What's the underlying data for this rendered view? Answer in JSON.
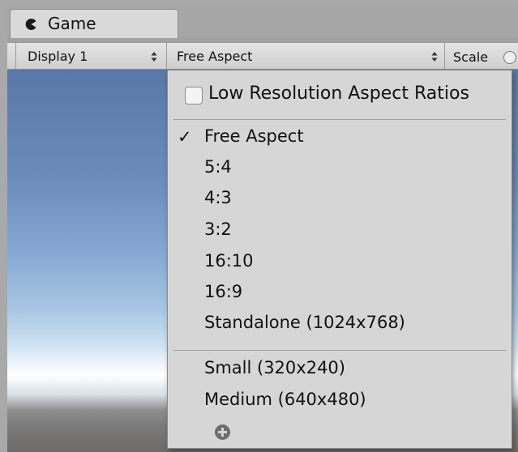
{
  "window": {
    "tab_label": "Game",
    "tab_icon": "pacman-game-icon"
  },
  "toolbar": {
    "display_value": "Display 1",
    "aspect_value": "Free Aspect",
    "scale_label": "Scale"
  },
  "menu": {
    "low_res_label": "Low Resolution Aspect Ratios",
    "low_res_checked": false,
    "check_glyph": "✓",
    "items": [
      {
        "label": "Free Aspect",
        "selected": true
      },
      {
        "label": "5:4"
      },
      {
        "label": "4:3"
      },
      {
        "label": "3:2"
      },
      {
        "label": "16:10"
      },
      {
        "label": "16:9"
      },
      {
        "label": "Standalone (1024x768)"
      },
      {
        "label": "Small (320x240)"
      },
      {
        "label": "Medium (640x480)"
      }
    ],
    "add_icon": "plus-circle-icon"
  }
}
